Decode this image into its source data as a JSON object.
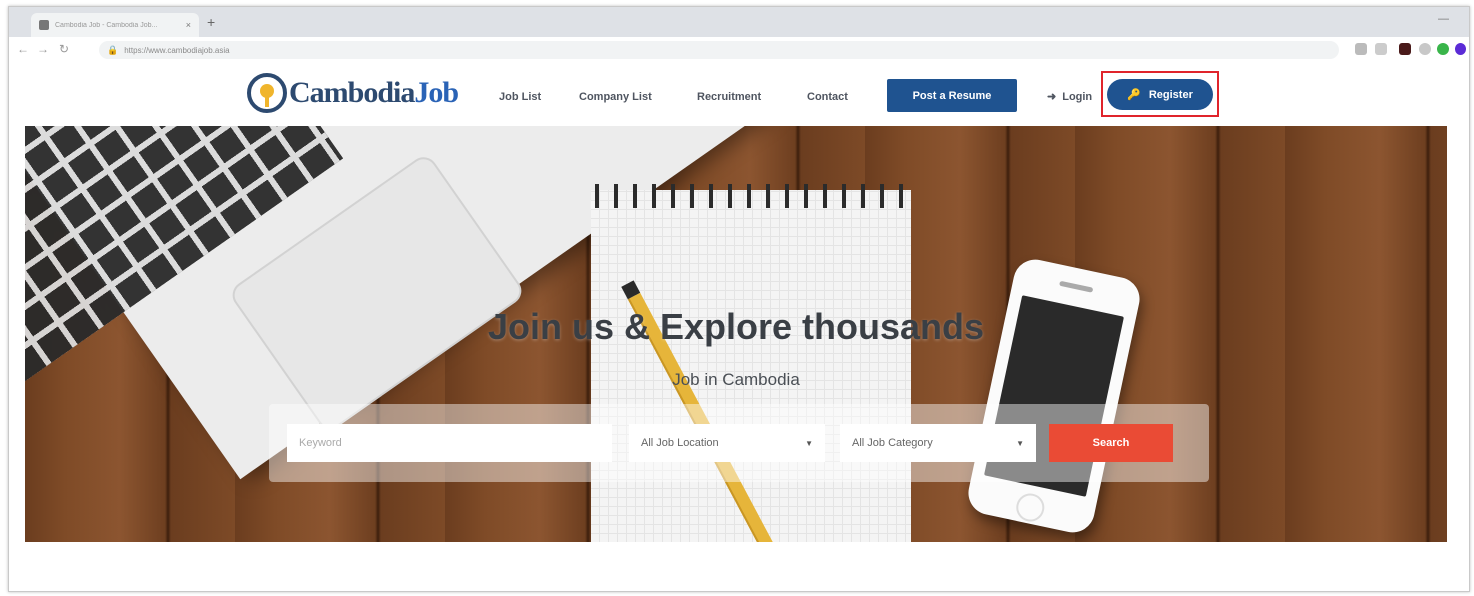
{
  "browser": {
    "tab_title": "Cambodia Job - Cambodia Job...",
    "tab_close": "×",
    "new_tab": "+",
    "window_controls": "—",
    "url": "https://www.cambodiajob.asia"
  },
  "site": {
    "logo_part1": "Cambodia",
    "logo_part2": "Job",
    "nav": [
      "Job List",
      "Company List",
      "Recruitment",
      "Contact"
    ],
    "post_resume": "Post a Resume",
    "login": "Login",
    "register": "Register"
  },
  "hero": {
    "title": "Join us & Explore thousands",
    "subtitle": "Job in Cambodia"
  },
  "search": {
    "keyword_placeholder": "Keyword",
    "location": "All Job Location",
    "category": "All Job Category",
    "button": "Search"
  },
  "colors": {
    "brand_blue": "#1f5390",
    "search_red": "#ea4b35",
    "highlight": "#e0242b"
  }
}
